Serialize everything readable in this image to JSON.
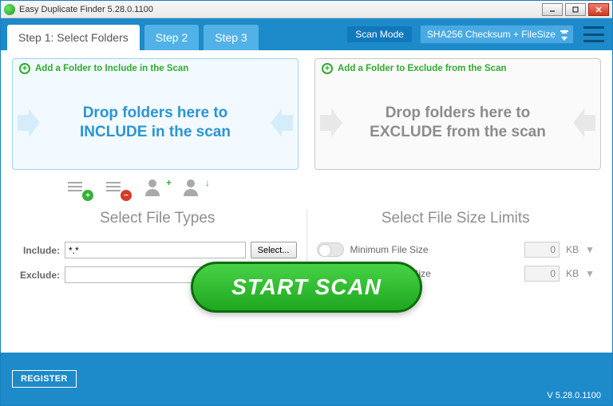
{
  "window": {
    "title": "Easy Duplicate Finder 5.28.0.1100"
  },
  "tabs": {
    "step1": "Step 1: Select Folders",
    "step2": "Step 2",
    "step3": "Step 3"
  },
  "scanMode": {
    "label": "Scan Mode",
    "value": "SHA256 Checksum + FileSize"
  },
  "include": {
    "addLabel": "Add a Folder to Include in the Scan",
    "dropLine1": "Drop folders here to",
    "dropLine2": "INCLUDE in the scan"
  },
  "exclude": {
    "addLabel": "Add a Folder to Exclude from the Scan",
    "dropLine1": "Drop folders here to",
    "dropLine2": "EXCLUDE from the scan"
  },
  "fileTypes": {
    "title": "Select File Types",
    "includeLabel": "Include:",
    "includeValue": "*.*",
    "excludeLabel": "Exclude:",
    "excludeValue": "",
    "selectBtn": "Select..."
  },
  "fileSize": {
    "title": "Select File Size Limits",
    "minLabel": "Minimum File Size",
    "maxLabel": "Maximum File Size",
    "minValue": "0",
    "maxValue": "0",
    "unit": "KB"
  },
  "scanBtn": "START  SCAN",
  "registerBtn": "REGISTER",
  "version": "V 5.28.0.1100"
}
